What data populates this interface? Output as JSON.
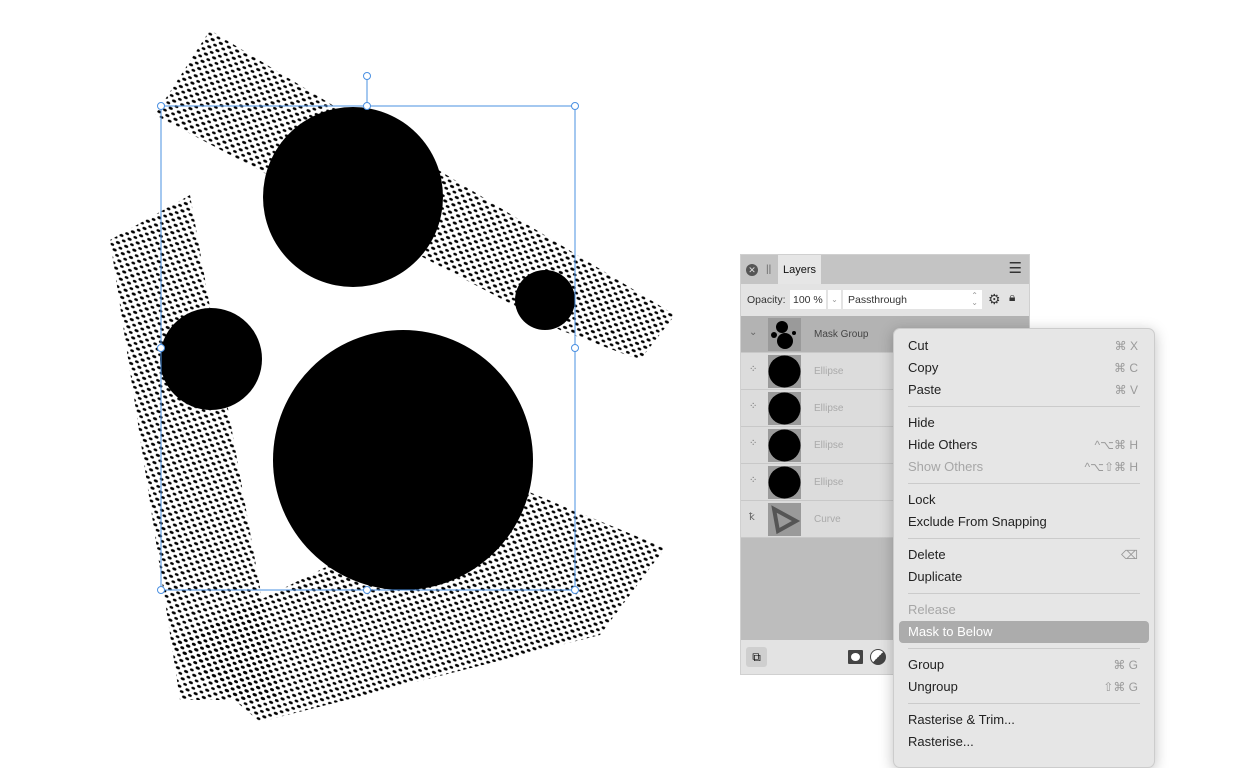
{
  "layers_panel": {
    "tab": "Layers",
    "opacity_label": "Opacity:",
    "opacity_value": "100 %",
    "blend_mode": "Passthrough",
    "layers": [
      {
        "name": "Mask Group",
        "type": "group"
      },
      {
        "name": "Ellipse",
        "type": "ellipse"
      },
      {
        "name": "Ellipse",
        "type": "ellipse"
      },
      {
        "name": "Ellipse",
        "type": "ellipse"
      },
      {
        "name": "Ellipse",
        "type": "ellipse"
      },
      {
        "name": "Curve",
        "type": "curve"
      }
    ]
  },
  "context_menu": {
    "items": [
      {
        "label": "Cut",
        "shortcut": "⌘ X"
      },
      {
        "label": "Copy",
        "shortcut": "⌘ C"
      },
      {
        "label": "Paste",
        "shortcut": "⌘ V"
      },
      {
        "label": "Hide",
        "shortcut": ""
      },
      {
        "label": "Hide Others",
        "shortcut": "^⌥⌘ H"
      },
      {
        "label": "Show Others",
        "shortcut": "^⌥⇧⌘ H"
      },
      {
        "label": "Lock",
        "shortcut": ""
      },
      {
        "label": "Exclude From Snapping",
        "shortcut": ""
      },
      {
        "label": "Delete",
        "shortcut": "⌫"
      },
      {
        "label": "Duplicate",
        "shortcut": ""
      },
      {
        "label": "Release",
        "shortcut": ""
      },
      {
        "label": "Mask to Below",
        "shortcut": ""
      },
      {
        "label": "Group",
        "shortcut": "⌘ G"
      },
      {
        "label": "Ungroup",
        "shortcut": "⇧⌘ G"
      },
      {
        "label": "Rasterise & Trim...",
        "shortcut": ""
      },
      {
        "label": "Rasterise...",
        "shortcut": ""
      }
    ]
  },
  "colors": {
    "selection": "#4a90e2",
    "highlight": "#acacac"
  }
}
